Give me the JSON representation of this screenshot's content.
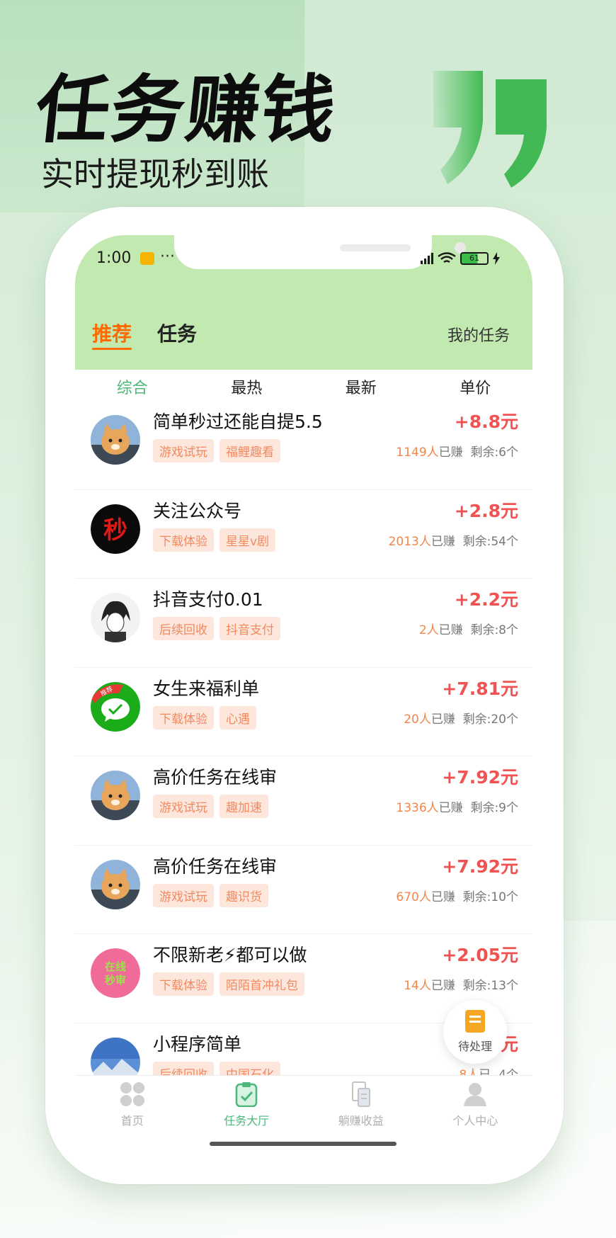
{
  "hero": {
    "title": "任务赚钱",
    "subtitle": "实时提现秒到账"
  },
  "colors": {
    "accent_green": "#4cb77a",
    "header_green": "#c2eab0",
    "price_red": "#f15252",
    "orange": "#ff6a00",
    "tag_bg": "#fde6dc",
    "tag_text": "#f28a60"
  },
  "status_bar": {
    "time": "1:00",
    "dots": "···",
    "battery": "61"
  },
  "header": {
    "tabs": [
      {
        "label": "推荐",
        "active": true
      },
      {
        "label": "任务",
        "active": false
      }
    ],
    "my_task": "我的任务"
  },
  "sort": [
    "综合",
    "最热",
    "最新",
    "单价"
  ],
  "tasks": [
    {
      "title": "简单秒过还能自提5.5",
      "price": "+8.8元",
      "tags": [
        "游戏试玩",
        "福鲤趣看"
      ],
      "earned": "1149人",
      "earned_suffix": "已赚",
      "remaining": "剩余:6个",
      "avatar": "cat-avatar"
    },
    {
      "title": "关注公众号",
      "price": "+2.8元",
      "tags": [
        "下载体验",
        "星星v剧"
      ],
      "earned": "2013人",
      "earned_suffix": "已赚",
      "remaining": "剩余:54个",
      "avatar": "red-badge-avatar"
    },
    {
      "title": "抖音支付0.01",
      "price": "+2.2元",
      "tags": [
        "后续回收",
        "抖音支付"
      ],
      "earned": "2人",
      "earned_suffix": "已赚",
      "remaining": "剩余:8个",
      "avatar": "manga-avatar"
    },
    {
      "title": "女生来福利单",
      "price": "+7.81元",
      "tags": [
        "下载体验",
        "心遇"
      ],
      "earned": "20人",
      "earned_suffix": "已赚",
      "remaining": "剩余:20个",
      "avatar": "wechat-avatar"
    },
    {
      "title": "高价任务在线审",
      "price": "+7.92元",
      "tags": [
        "游戏试玩",
        "趣加速"
      ],
      "earned": "1336人",
      "earned_suffix": "已赚",
      "remaining": "剩余:9个",
      "avatar": "cat-avatar"
    },
    {
      "title": "高价任务在线审",
      "price": "+7.92元",
      "tags": [
        "游戏试玩",
        "趣识货"
      ],
      "earned": "670人",
      "earned_suffix": "已赚",
      "remaining": "剩余:10个",
      "avatar": "cat-avatar"
    },
    {
      "title": "不限新老⚡都可以做",
      "price": "+2.05元",
      "tags": [
        "下载体验",
        "陌陌首冲礼包"
      ],
      "earned": "14人",
      "earned_suffix": "已赚",
      "remaining": "剩余:13个",
      "avatar": "pink-avatar"
    },
    {
      "title": "小程序简单",
      "price": "元",
      "tags": [
        "后续回收",
        "中国石化"
      ],
      "earned": "8人",
      "earned_suffix": "已",
      "remaining": "4个",
      "avatar": "landscape-avatar"
    }
  ],
  "avatar_text": {
    "red_badge": "秒",
    "wechat_ribbon": "推荐",
    "pink": [
      "在线",
      "秒审"
    ]
  },
  "fab": {
    "label": "待处理"
  },
  "tabbar": [
    {
      "label": "首页",
      "icon": "grid-icon",
      "active": false
    },
    {
      "label": "任务大厅",
      "icon": "clipboard-check-icon",
      "active": true
    },
    {
      "label": "躺赚收益",
      "icon": "document-icon",
      "active": false
    },
    {
      "label": "个人中心",
      "icon": "person-icon",
      "active": false
    }
  ]
}
